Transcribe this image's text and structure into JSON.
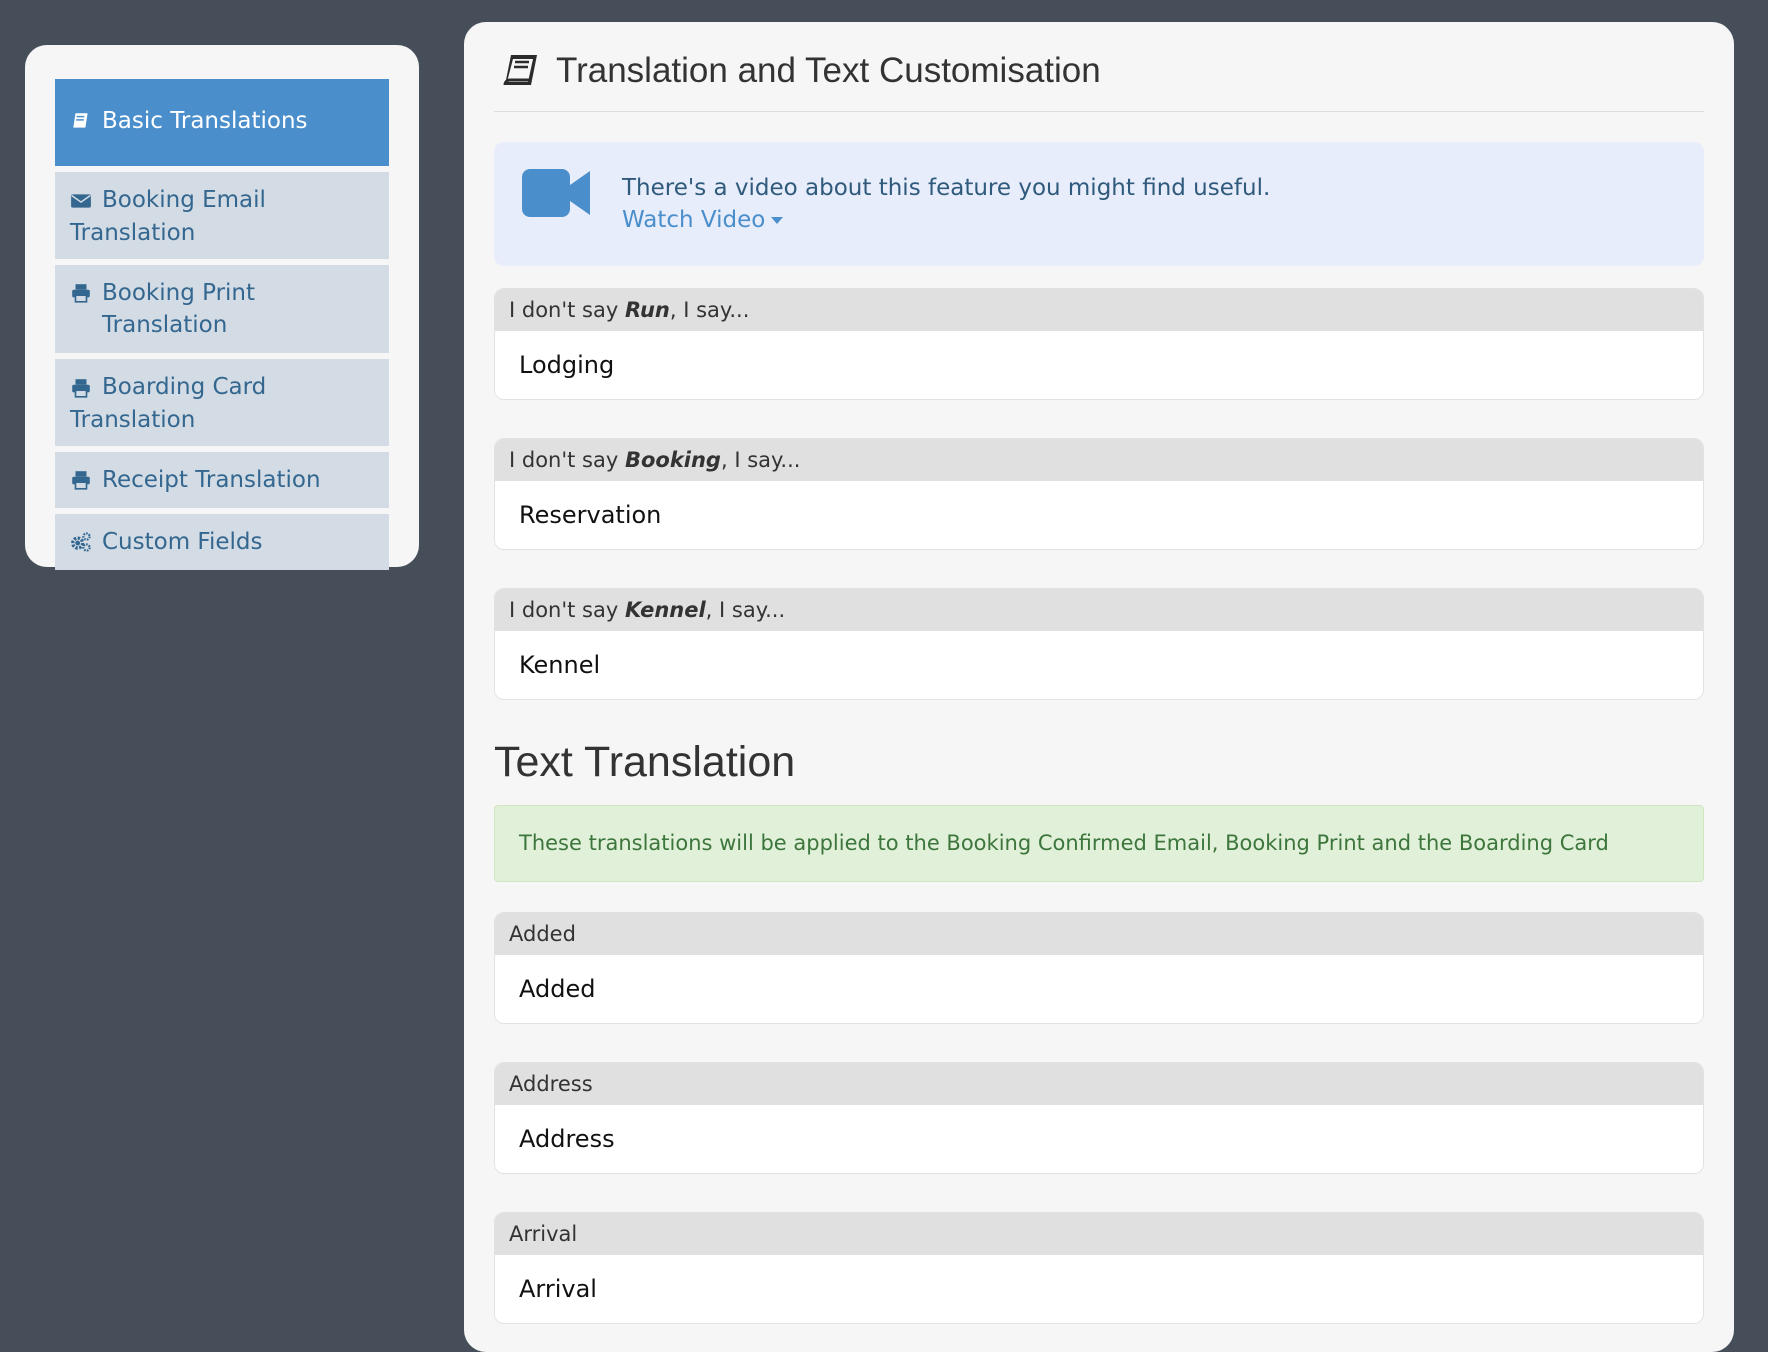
{
  "sidebar": {
    "items": [
      {
        "label": "Basic Translations",
        "icon": "book-icon",
        "active": true
      },
      {
        "label": "Booking Email Translation",
        "icon": "envelope-icon",
        "active": false
      },
      {
        "label": "Booking Print Translation",
        "icon": "print-icon",
        "active": false
      },
      {
        "label": "Boarding Card Translation",
        "icon": "print-icon",
        "active": false
      },
      {
        "label": "Receipt Translation",
        "icon": "print-icon",
        "active": false
      },
      {
        "label": "Custom Fields",
        "icon": "cogs-icon",
        "active": false
      }
    ]
  },
  "header": {
    "title": "Translation and Text Customisation"
  },
  "video_alert": {
    "message": "There's a video about this feature you might find useful.",
    "link_label": "Watch Video"
  },
  "basic_fields": [
    {
      "prefix": "I don't say ",
      "term": "Run",
      "suffix": ", I say...",
      "value": "Lodging"
    },
    {
      "prefix": "I don't say ",
      "term": "Booking",
      "suffix": ", I say...",
      "value": "Reservation"
    },
    {
      "prefix": "I don't say ",
      "term": "Kennel",
      "suffix": ", I say...",
      "value": "Kennel"
    }
  ],
  "text_translation": {
    "title": "Text Translation",
    "notice": "These translations will be applied to the Booking Confirmed Email, Booking Print and the Boarding Card",
    "fields": [
      {
        "label": "Added",
        "value": "Added"
      },
      {
        "label": "Address",
        "value": "Address"
      },
      {
        "label": "Arrival",
        "value": "Arrival"
      }
    ]
  },
  "colors": {
    "background": "#454e59",
    "accent": "#4a8ecb",
    "sidebar_item": "#d3dbe5",
    "success_bg": "#e1f0d8",
    "info_bg": "#e8edfb"
  }
}
